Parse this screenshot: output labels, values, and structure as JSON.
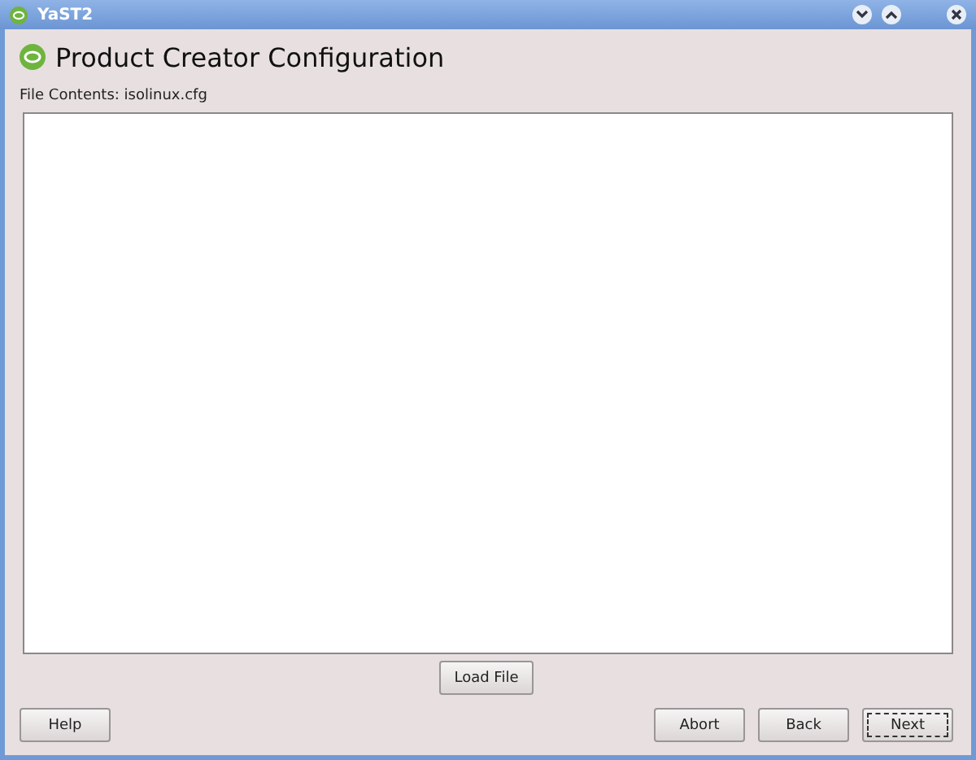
{
  "window": {
    "title": "YaST2"
  },
  "heading": "Product Creator Configuration",
  "file_contents": {
    "label": "File Contents: isolinux.cfg"
  },
  "load_button": "Load File",
  "buttons": [
    {
      "label": "Help",
      "kind": "left",
      "focused": false
    },
    {
      "label": "Abort",
      "kind": "right",
      "focused": false
    },
    {
      "label": "Back",
      "kind": "right",
      "focused": false
    },
    {
      "label": "Next",
      "kind": "right",
      "focused": true
    }
  ]
}
